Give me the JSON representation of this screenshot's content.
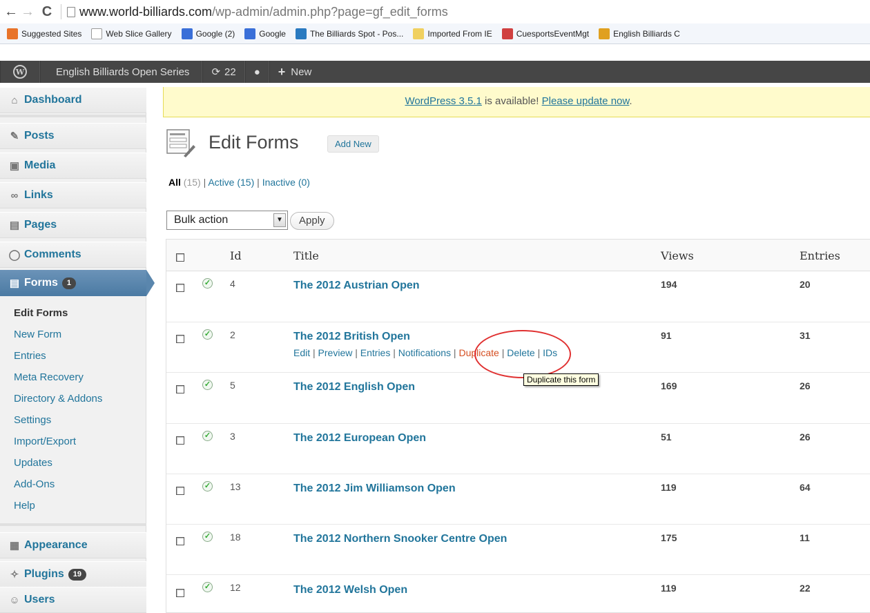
{
  "browser": {
    "url_host": "www.world-billiards.com",
    "url_path": "/wp-admin/admin.php?page=gf_edit_forms",
    "bookmarks": [
      {
        "label": "Suggested Sites",
        "icon": "suggested-sites-icon",
        "color": "#e8732a"
      },
      {
        "label": "Web Slice Gallery",
        "icon": "page-icon",
        "color": "#ffffff"
      },
      {
        "label": "Google (2)",
        "icon": "google-icon",
        "color": "#3a6fd8"
      },
      {
        "label": "Google",
        "icon": "google-icon",
        "color": "#3a6fd8"
      },
      {
        "label": "The Billiards Spot - Pos...",
        "icon": "billiards-spot-icon",
        "color": "#2a7ac0"
      },
      {
        "label": "Imported From IE",
        "icon": "folder-icon",
        "color": "#f0d060"
      },
      {
        "label": "CuesportsEventMgt",
        "icon": "cuesports-icon",
        "color": "#d04040"
      },
      {
        "label": "English Billiards C",
        "icon": "english-billiards-icon",
        "color": "#e0a020"
      }
    ]
  },
  "adminbar": {
    "site_name": "English Billiards Open Series",
    "updates_count": "22",
    "new_label": "New"
  },
  "sidebar": {
    "menu": [
      {
        "label": "Dashboard",
        "icon": "home-icon"
      },
      {
        "label": "Posts",
        "icon": "pushpin-icon"
      },
      {
        "label": "Media",
        "icon": "media-icon"
      },
      {
        "label": "Links",
        "icon": "link-icon"
      },
      {
        "label": "Pages",
        "icon": "pages-icon"
      },
      {
        "label": "Comments",
        "icon": "comment-icon"
      },
      {
        "label": "Forms",
        "icon": "forms-icon",
        "badge": "1"
      },
      {
        "label": "Appearance",
        "icon": "appearance-icon"
      },
      {
        "label": "Plugins",
        "icon": "plugin-icon",
        "badge": "19"
      },
      {
        "label": "Users",
        "icon": "users-icon"
      }
    ],
    "submenu": [
      "Edit Forms",
      "New Form",
      "Entries",
      "Meta Recovery",
      "Directory & Addons",
      "Settings",
      "Import/Export",
      "Updates",
      "Add-Ons",
      "Help"
    ]
  },
  "notice": {
    "text": "WordPress 3.5.1",
    "mid": " is available! ",
    "link": "Please update now",
    "end": "."
  },
  "page": {
    "title": "Edit Forms",
    "add_new": "Add New",
    "filters": {
      "all": "All",
      "all_count": "(15)",
      "active": "Active",
      "active_count": "(15)",
      "inactive": "Inactive",
      "inactive_count": "(0)"
    },
    "bulk_action": "Bulk action",
    "apply": "Apply"
  },
  "table": {
    "headers": {
      "id": "Id",
      "title": "Title",
      "views": "Views",
      "entries": "Entries"
    },
    "rows": [
      {
        "id": "4",
        "title": "The 2012 Austrian Open",
        "views": "194",
        "entries": "20"
      },
      {
        "id": "2",
        "title": "The 2012 British Open",
        "views": "91",
        "entries": "31"
      },
      {
        "id": "5",
        "title": "The 2012 English Open",
        "views": "169",
        "entries": "26"
      },
      {
        "id": "3",
        "title": "The 2012 European Open",
        "views": "51",
        "entries": "26"
      },
      {
        "id": "13",
        "title": "The 2012 Jim Williamson Open",
        "views": "119",
        "entries": "64"
      },
      {
        "id": "18",
        "title": "The 2012 Northern Snooker Centre Open",
        "views": "175",
        "entries": "11"
      },
      {
        "id": "12",
        "title": "The 2012 Welsh Open",
        "views": "119",
        "entries": "22"
      }
    ],
    "row_actions": [
      "Edit",
      "Preview",
      "Entries",
      "Notifications",
      "Duplicate",
      "Delete",
      "IDs"
    ],
    "tooltip": "Duplicate this form"
  }
}
